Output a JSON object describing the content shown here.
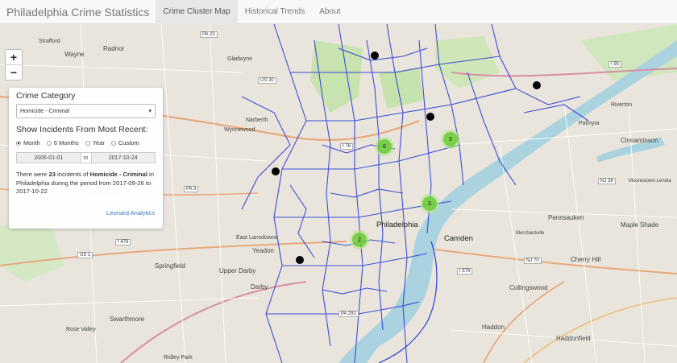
{
  "app": {
    "title": "Philadelphia Crime Statistics"
  },
  "nav": [
    {
      "label": "Crime Cluster Map"
    },
    {
      "label": "Historical Trends"
    },
    {
      "label": "About"
    }
  ],
  "zoom": {
    "in": "+",
    "out": "−"
  },
  "panel": {
    "category_label": "Crime Category",
    "category_value": "Homicide - Criminal",
    "range_label": "Show Incidents From Most Recent:",
    "options": [
      "Month",
      "6 Months",
      "Year",
      "Custom"
    ],
    "selected_option": "Month",
    "date_from": "2006-01-01",
    "date_sep": "to",
    "date_to": "2017-10-24",
    "summary": {
      "pre": "There were ",
      "count": "23",
      "mid": " incidents of ",
      "category": "Homicide - Criminal",
      "post": " in Philadelphia during the period from 2017-09-26 to 2017-10-22"
    },
    "credit": "Leonard Analytics"
  },
  "clusters": [
    "6",
    "5",
    "3",
    "2"
  ],
  "map_labels": {
    "philadelphia": "Philadelphia",
    "camden": "Camden",
    "cinnaminson": "Cinnaminson",
    "pennsauken": "Pennsauken",
    "maple_shade": "Maple Shade",
    "cherry_hill": "Cherry Hill",
    "collingswood": "Collingswood",
    "haddonfield": "Haddonfield",
    "haddon": "Haddon",
    "springfield": "Springfield",
    "upper_darby": "Upper Darby",
    "yeadon": "Yeadon",
    "darby": "Darby",
    "swarthmore": "Swarthmore",
    "wayne": "Wayne",
    "radnor": "Radnor",
    "wynnewood": "Wynnewood",
    "gladwyne": "Gladwyne",
    "narberth": "Narberth",
    "palmyra": "Palmyra",
    "riverton": "Riverton",
    "west_lansdowne": "East Lansdowne",
    "rose_valley": "Rose Valley",
    "merchantville": "Merchantville",
    "strafford": "Strafford",
    "ridley_park": "Ridley Park",
    "moorestown": "Moorestown-Lenola"
  },
  "shields": [
    "PA 23",
    "I 476",
    "US 1",
    "I 95",
    "I 76",
    "NJ 70",
    "PA 3",
    "US 30",
    "PA 291",
    "I 676",
    "NJ 38"
  ],
  "colors": {
    "accent": "#337ab7",
    "cluster": "#6ecc39",
    "boundary": "#2b3fd6"
  }
}
